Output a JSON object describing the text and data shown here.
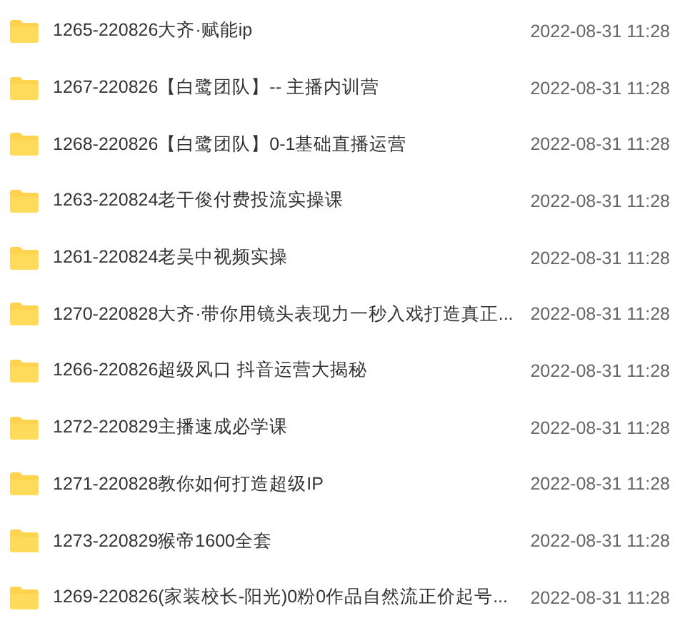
{
  "files": [
    {
      "name": "1265-220826大齐·赋能ip",
      "modified": "2022-08-31 11:28"
    },
    {
      "name": "1267-220826【白鹭团队】-- 主播内训营",
      "modified": "2022-08-31 11:28"
    },
    {
      "name": "1268-220826【白鹭团队】0-1基础直播运营",
      "modified": "2022-08-31 11:28"
    },
    {
      "name": "1263-220824老干俊付费投流实操课",
      "modified": "2022-08-31 11:28"
    },
    {
      "name": "1261-220824老吴中视频实操",
      "modified": "2022-08-31 11:28"
    },
    {
      "name": "1270-220828大齐·带你用镜头表现力一秒入戏打造真正...",
      "modified": "2022-08-31 11:28"
    },
    {
      "name": "1266-220826超级风口 抖音运营大揭秘",
      "modified": "2022-08-31 11:28"
    },
    {
      "name": "1272-220829主播速成必学课",
      "modified": "2022-08-31 11:28"
    },
    {
      "name": "1271-220828教你如何打造超级IP",
      "modified": "2022-08-31 11:28"
    },
    {
      "name": "1273-220829猴帝1600全套",
      "modified": "2022-08-31 11:28"
    },
    {
      "name": "1269-220826(家装校长-阳光)0粉0作品自然流正价起号...",
      "modified": "2022-08-31 11:28"
    }
  ]
}
